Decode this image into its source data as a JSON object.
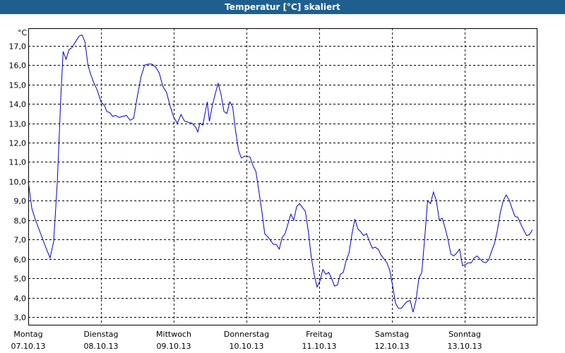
{
  "window": {
    "title": "Temperatur [°C] skaliert"
  },
  "chart_data": {
    "type": "line",
    "title": "Temperatur [°C] skaliert",
    "ylabel": "°C",
    "ylim": [
      2.6,
      17.9
    ],
    "yticks": [
      "3,0",
      "4,0",
      "5,0",
      "6,0",
      "7,0",
      "8,0",
      "9,0",
      "10,0",
      "11,0",
      "12,0",
      "13,0",
      "14,0",
      "15,0",
      "16,0",
      "17,0"
    ],
    "grid": true,
    "days": [
      {
        "name": "Montag",
        "date": "07.10.13"
      },
      {
        "name": "Dienstag",
        "date": "08.10.13"
      },
      {
        "name": "Mittwoch",
        "date": "09.10.13"
      },
      {
        "name": "Donnerstag",
        "date": "10.10.13"
      },
      {
        "name": "Freitag",
        "date": "11.10.13"
      },
      {
        "name": "Samstag",
        "date": "12.10.13"
      },
      {
        "name": "Sonntag",
        "date": "13.10.13"
      }
    ],
    "xlim": [
      0,
      7
    ],
    "series": [
      {
        "color": "#0000cc",
        "points": [
          [
            0.0,
            10.0
          ],
          [
            0.05,
            8.6
          ],
          [
            0.1,
            8.0
          ],
          [
            0.15,
            7.5
          ],
          [
            0.2,
            7.0
          ],
          [
            0.25,
            6.5
          ],
          [
            0.3,
            6.05
          ],
          [
            0.35,
            6.9
          ],
          [
            0.4,
            10.0
          ],
          [
            0.45,
            14.5
          ],
          [
            0.48,
            16.7
          ],
          [
            0.52,
            16.3
          ],
          [
            0.56,
            16.8
          ],
          [
            0.6,
            16.9
          ],
          [
            0.65,
            17.2
          ],
          [
            0.7,
            17.5
          ],
          [
            0.74,
            17.55
          ],
          [
            0.78,
            17.2
          ],
          [
            0.82,
            16.0
          ],
          [
            0.86,
            15.5
          ],
          [
            0.9,
            15.1
          ],
          [
            0.95,
            14.7
          ],
          [
            1.0,
            14.1
          ],
          [
            1.05,
            13.9
          ],
          [
            1.08,
            13.6
          ],
          [
            1.12,
            13.55
          ],
          [
            1.16,
            13.35
          ],
          [
            1.2,
            13.4
          ],
          [
            1.25,
            13.3
          ],
          [
            1.3,
            13.35
          ],
          [
            1.35,
            13.4
          ],
          [
            1.4,
            13.15
          ],
          [
            1.45,
            13.25
          ],
          [
            1.5,
            14.4
          ],
          [
            1.55,
            15.4
          ],
          [
            1.6,
            16.0
          ],
          [
            1.65,
            16.05
          ],
          [
            1.7,
            16.05
          ],
          [
            1.75,
            15.9
          ],
          [
            1.8,
            15.6
          ],
          [
            1.85,
            14.9
          ],
          [
            1.9,
            14.6
          ],
          [
            1.95,
            13.9
          ],
          [
            2.0,
            13.3
          ],
          [
            2.05,
            13.0
          ],
          [
            2.1,
            13.45
          ],
          [
            2.15,
            13.1
          ],
          [
            2.2,
            13.05
          ],
          [
            2.25,
            13.0
          ],
          [
            2.3,
            12.8
          ],
          [
            2.33,
            12.55
          ],
          [
            2.36,
            13.0
          ],
          [
            2.4,
            12.9
          ],
          [
            2.43,
            13.5
          ],
          [
            2.46,
            14.1
          ],
          [
            2.49,
            13.1
          ],
          [
            2.53,
            13.9
          ],
          [
            2.57,
            14.5
          ],
          [
            2.61,
            15.05
          ],
          [
            2.65,
            14.5
          ],
          [
            2.69,
            13.6
          ],
          [
            2.73,
            13.5
          ],
          [
            2.77,
            14.1
          ],
          [
            2.81,
            13.85
          ],
          [
            2.85,
            12.6
          ],
          [
            2.89,
            11.6
          ],
          [
            2.93,
            11.2
          ],
          [
            2.97,
            11.3
          ],
          [
            3.01,
            11.3
          ],
          [
            3.05,
            11.25
          ],
          [
            3.09,
            10.8
          ],
          [
            3.13,
            10.5
          ],
          [
            3.17,
            9.5
          ],
          [
            3.21,
            8.5
          ],
          [
            3.25,
            7.3
          ],
          [
            3.29,
            7.15
          ],
          [
            3.33,
            6.95
          ],
          [
            3.37,
            6.75
          ],
          [
            3.41,
            6.75
          ],
          [
            3.45,
            6.5
          ],
          [
            3.49,
            7.1
          ],
          [
            3.53,
            7.3
          ],
          [
            3.57,
            7.8
          ],
          [
            3.61,
            8.3
          ],
          [
            3.65,
            8.0
          ],
          [
            3.69,
            8.7
          ],
          [
            3.73,
            8.85
          ],
          [
            3.77,
            8.65
          ],
          [
            3.81,
            8.45
          ],
          [
            3.85,
            7.4
          ],
          [
            3.89,
            6.1
          ],
          [
            3.93,
            5.2
          ],
          [
            3.97,
            4.55
          ],
          [
            4.01,
            4.85
          ],
          [
            4.05,
            5.45
          ],
          [
            4.09,
            5.2
          ],
          [
            4.13,
            5.3
          ],
          [
            4.17,
            5.0
          ],
          [
            4.21,
            4.6
          ],
          [
            4.25,
            4.65
          ],
          [
            4.29,
            5.2
          ],
          [
            4.33,
            5.3
          ],
          [
            4.37,
            5.9
          ],
          [
            4.41,
            6.3
          ],
          [
            4.45,
            7.3
          ],
          [
            4.49,
            8.05
          ],
          [
            4.53,
            7.55
          ],
          [
            4.57,
            7.4
          ],
          [
            4.61,
            7.2
          ],
          [
            4.65,
            7.3
          ],
          [
            4.69,
            6.9
          ],
          [
            4.73,
            6.55
          ],
          [
            4.77,
            6.6
          ],
          [
            4.81,
            6.5
          ],
          [
            4.85,
            6.2
          ],
          [
            4.89,
            6.0
          ],
          [
            4.93,
            5.8
          ],
          [
            4.97,
            5.4
          ],
          [
            5.01,
            4.6
          ],
          [
            5.05,
            3.7
          ],
          [
            5.09,
            3.45
          ],
          [
            5.13,
            3.45
          ],
          [
            5.17,
            3.65
          ],
          [
            5.21,
            3.8
          ],
          [
            5.25,
            3.85
          ],
          [
            5.29,
            3.25
          ],
          [
            5.33,
            3.85
          ],
          [
            5.37,
            5.0
          ],
          [
            5.41,
            5.3
          ],
          [
            5.45,
            7.1
          ],
          [
            5.49,
            9.0
          ],
          [
            5.53,
            8.85
          ],
          [
            5.57,
            9.45
          ],
          [
            5.61,
            9.0
          ],
          [
            5.65,
            8.0
          ],
          [
            5.69,
            8.1
          ],
          [
            5.73,
            7.6
          ],
          [
            5.77,
            7.0
          ],
          [
            5.81,
            6.25
          ],
          [
            5.85,
            6.15
          ],
          [
            5.89,
            6.3
          ],
          [
            5.93,
            6.5
          ],
          [
            5.97,
            5.65
          ],
          [
            6.01,
            5.7
          ],
          [
            6.05,
            5.8
          ],
          [
            6.09,
            5.8
          ],
          [
            6.13,
            6.05
          ],
          [
            6.17,
            6.15
          ],
          [
            6.21,
            6.0
          ],
          [
            6.25,
            5.85
          ],
          [
            6.29,
            5.8
          ],
          [
            6.33,
            5.95
          ],
          [
            6.37,
            6.4
          ],
          [
            6.41,
            6.8
          ],
          [
            6.45,
            7.5
          ],
          [
            6.49,
            8.4
          ],
          [
            6.53,
            9.0
          ],
          [
            6.57,
            9.3
          ],
          [
            6.61,
            9.05
          ],
          [
            6.65,
            8.6
          ],
          [
            6.69,
            8.2
          ],
          [
            6.73,
            8.15
          ],
          [
            6.77,
            7.8
          ],
          [
            6.81,
            7.5
          ],
          [
            6.85,
            7.2
          ],
          [
            6.89,
            7.25
          ],
          [
            6.93,
            7.5
          ]
        ]
      }
    ]
  }
}
